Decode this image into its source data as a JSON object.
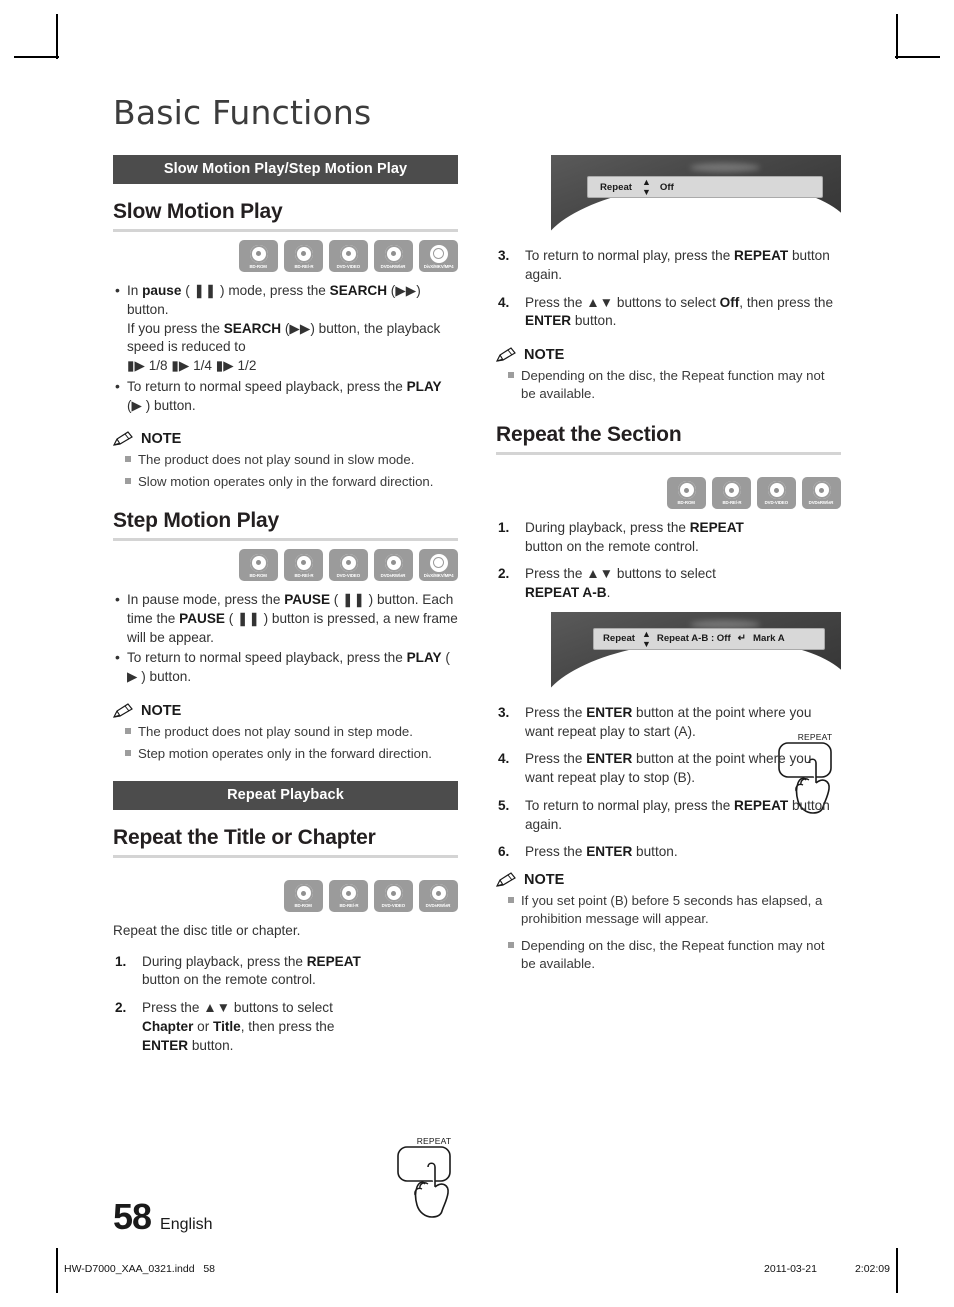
{
  "document": {
    "title": "Basic Functions",
    "page_number": "58",
    "language": "English"
  },
  "production_footer": {
    "file": "HW-D7000_XAA_0321.indd",
    "page": "58",
    "date": "2011-03-21",
    "time": "2:02:09"
  },
  "disc_labels": {
    "bd_rom": "BD-ROM",
    "bd_re_r": "BD-RE/-R",
    "dvd_video": "DVD-VIDEO",
    "dvd_rw_r": "DVD±RW/±R",
    "divx": "DivX/MKV/MP4"
  },
  "left_column": {
    "banner_slow": "Slow Motion Play/Step Motion Play",
    "banner_repeat": "Repeat Playback",
    "slow_motion": {
      "heading": "Slow Motion Play",
      "bullet1_a": "In ",
      "bullet1_pause": "pause",
      "bullet1_b": " ( ❚❚ ) mode, press the ",
      "bullet1_search": "SEARCH",
      "bullet1_c": " (▶▶) button.",
      "bullet1_d": "If you press the ",
      "bullet1_e": " (▶▶) button, the playback speed is reduced to",
      "bullet1_speeds": "▮▶ 1/8 ▮▶ 1/4 ▮▶ 1/2",
      "bullet2_a": "To return to normal speed playback, press the ",
      "bullet2_play": "PLAY",
      "bullet2_b": " (▶ ) button."
    },
    "note_slow": {
      "title": "NOTE",
      "items": [
        "The product does not play sound in slow mode.",
        "Slow motion operates only in the forward direction."
      ]
    },
    "step_motion": {
      "heading": "Step Motion Play",
      "bullet1_a": "In pause mode, press the ",
      "bullet1_pause": "PAUSE",
      "bullet1_b": " ( ❚❚ ) button. Each time the ",
      "bullet1_c": " ( ❚❚ ) button is pressed, a new frame will be appear.",
      "bullet2_a": "To return to normal speed playback, press the ",
      "bullet2_play": "PLAY",
      "bullet2_b": " ( ▶ ) button."
    },
    "note_step": {
      "title": "NOTE",
      "items": [
        "The product does not play sound in step mode.",
        "Step motion operates only in the forward direction."
      ]
    },
    "repeat_title": {
      "heading": "Repeat the Title or Chapter",
      "intro": "Repeat the disc title or chapter.",
      "step1_num": "1.",
      "step1_a": "During playback, press the ",
      "step1_repeat": "REPEAT",
      "step1_b": " button on the remote control.",
      "step2_num": "2.",
      "step2_a": "Press the ▲▼ buttons to select ",
      "step2_chapter": "Chapter",
      "step2_or": " or ",
      "step2_title": "Title",
      "step2_b": ", then press the ",
      "step2_enter": "ENTER",
      "step2_c": " button."
    },
    "remote_caption": "REPEAT"
  },
  "right_column": {
    "osd_top": {
      "label": "Repeat",
      "updown_icon": "up-down-arrow-icon",
      "value": "Off"
    },
    "repeat_title_steps": {
      "step3_num": "3.",
      "step3_a": "To return to normal play, press the ",
      "step3_repeat": "REPEAT",
      "step3_b": " button again.",
      "step4_num": "4.",
      "step4_a": "Press the ▲▼ buttons to select ",
      "step4_off": "Off",
      "step4_b": ", then press the ",
      "step4_enter": "ENTER",
      "step4_c": " button."
    },
    "note_repeat": {
      "title": "NOTE",
      "items": [
        "Depending on the disc, the Repeat function may not be available."
      ]
    },
    "repeat_section": {
      "heading": "Repeat the Section",
      "step1_num": "1.",
      "step1_a": "During playback, press the ",
      "step1_repeat": "REPEAT",
      "step1_b": " button on the remote control.",
      "step2_num": "2.",
      "step2_a": "Press the ▲▼ buttons to select ",
      "step2_ab": "REPEAT A-B",
      "step2_b": "."
    },
    "remote_caption": "REPEAT",
    "osd_bottom": {
      "label": "Repeat",
      "updown_icon": "up-down-arrow-icon",
      "value": "Repeat A-B : Off",
      "enter_icon": "enter-key-icon",
      "mark": "Mark A"
    },
    "repeat_section_steps": {
      "step3_num": "3.",
      "step3_a": "Press the ",
      "step3_enter": "ENTER",
      "step3_b": " button at the point where you want repeat play to start (A).",
      "step4_num": "4.",
      "step4_a": "Press the ",
      "step4_enter": "ENTER",
      "step4_b": " button at the point where you want repeat play to stop (B).",
      "step5_num": "5.",
      "step5_a": "To return to normal play, press the ",
      "step5_repeat": "REPEAT",
      "step5_b": " button again.",
      "step6_num": "6.",
      "step6_a": "Press the ",
      "step6_enter": "ENTER",
      "step6_b": " button."
    },
    "note_section": {
      "title": "NOTE",
      "items": [
        "If you set point (B) before 5 seconds has elapsed, a prohibition message will appear.",
        "Depending on the disc, the Repeat function may not be available."
      ]
    }
  }
}
